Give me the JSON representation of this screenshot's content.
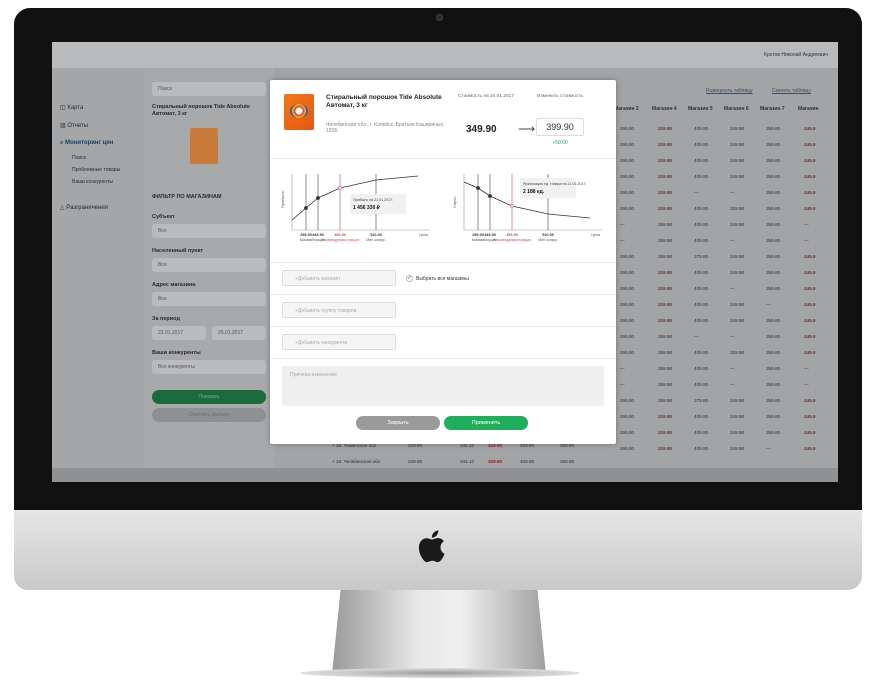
{
  "topbar": {
    "user": "Кротов Николай Андреевич"
  },
  "sidebar": {
    "items": [
      {
        "label": "Карта"
      },
      {
        "label": "Отчеты"
      },
      {
        "label": "Мониторинг цен"
      }
    ],
    "subitems": [
      {
        "label": "Поиск"
      },
      {
        "label": "Проблемные товары"
      },
      {
        "label": "Ваши конкуренты"
      }
    ],
    "extra": {
      "label": "Разграничения"
    }
  },
  "filters": {
    "search": "Поиск",
    "product": "Стиральный порошок Tide Absolute Автомат, 3 кг",
    "title": "ФИЛЬТР ПО МАГАЗИНАМ",
    "subject_label": "Субъект",
    "subject_value": "Все",
    "city_label": "Населенный пункт",
    "city_value": "Все",
    "address_label": "Адрес магазина",
    "address_value": "Все",
    "period_label": "За период",
    "date_from": "22.01.2017",
    "date_to": "25.01.2017",
    "competitors_label": "Ваши конкуренты",
    "competitors_value": "Все конкуренты",
    "show": "Показать",
    "clear": "Очистить фильтр"
  },
  "table": {
    "links": [
      "Развернуть таблицу",
      "Скачать таблицу"
    ],
    "headers": [
      "Магазин 2",
      "Магазин 4",
      "Магазин 5",
      "Магазин 6",
      "Магазин 7",
      "Магазин"
    ],
    "rows": [
      [
        "299.90",
        "329.90",
        "409.90",
        "349.90",
        "359.90",
        "345.9"
      ],
      [
        "299.90",
        "329.90",
        "409.90",
        "349.90",
        "359.90",
        "345.9"
      ],
      [
        "299.90",
        "329.90",
        "409.90",
        "349.90",
        "359.90",
        "345.9"
      ],
      [
        "299.90",
        "329.90",
        "409.90",
        "349.90",
        "359.90",
        "345.9"
      ],
      [
        "299.90",
        "329.90",
        "—",
        "—",
        "359.90",
        "345.9"
      ],
      [
        "299.90",
        "329.90",
        "409.90",
        "329.90",
        "359.90",
        "349.9"
      ],
      [
        "—",
        "359.90",
        "409.90",
        "349.90",
        "359.90",
        "—"
      ],
      [
        "—",
        "359.90",
        "409.90",
        "—",
        "359.90",
        "—"
      ],
      [
        "299.90",
        "359.90",
        "379.90",
        "349.90",
        "359.90",
        "345.9"
      ],
      [
        "299.90",
        "329.90",
        "409.90",
        "349.90",
        "359.90",
        "345.9"
      ],
      [
        "299.90",
        "329.90",
        "409.90",
        "—",
        "359.90",
        "345.9"
      ],
      [
        "299.90",
        "329.90",
        "409.90",
        "349.90",
        "—",
        "345.9"
      ],
      [
        "299.90",
        "329.90",
        "409.90",
        "349.90",
        "359.90",
        "345.9"
      ],
      [
        "299.90",
        "359.90",
        "—",
        "—",
        "359.90",
        "349.9"
      ],
      [
        "299.90",
        "359.90",
        "409.90",
        "329.90",
        "359.90",
        "349.9"
      ],
      [
        "—",
        "359.90",
        "409.90",
        "—",
        "359.90",
        "—"
      ],
      [
        "—",
        "359.90",
        "409.90",
        "—",
        "359.90",
        "—"
      ],
      [
        "299.90",
        "359.90",
        "379.90",
        "349.90",
        "359.90",
        "345.9"
      ],
      [
        "299.90",
        "329.90",
        "409.90",
        "349.90",
        "359.90",
        "345.9"
      ],
      [
        "299.90",
        "329.90",
        "409.90",
        "349.90",
        "359.90",
        "345.9"
      ],
      [
        "299.90",
        "329.90",
        "409.90",
        "349.90",
        "—",
        "345.9"
      ]
    ],
    "bottom_rows": [
      {
        "name": "+ 18. Тюменская обл",
        "a": "349.90",
        "b": "344.10",
        "c": "329.90",
        "d": "409.90",
        "e": "359.90"
      },
      {
        "name": "+ 19. Челябинская обл",
        "a": "349.90",
        "b": "344.10",
        "c": "329.90",
        "d": "409.90",
        "e": "359.90"
      }
    ]
  },
  "modal": {
    "title": "Стиральный порошок Tide Absolute Автомат, 3 кг",
    "address": "Челябинская обл., г. Копейск, Братьев Кашириных, 120Б",
    "cost_label": "Стоимость на 20.01.2017",
    "change_label": "Изменить стоимость",
    "old_price": "349.90",
    "arrow": "⟶",
    "new_price": "399.90",
    "diff": "+50.00",
    "chart1": {
      "ylabel": "Прибыль",
      "tooltip_title": "Прибыль на 21.01.2017:",
      "tooltip_value": "1 456 330 ₽",
      "ticks": [
        "299.90",
        "349.90",
        "359.90",
        "510.00"
      ],
      "tick_labels": [
        "Базовая",
        "Текущая",
        "Рекомендуемая позиция",
        "Мин. конкур."
      ],
      "unit": "Цена"
    },
    "chart2": {
      "ylabel": "Спрос",
      "tooltip_title": "Реализация ед. товара на 21.01.2017:",
      "tooltip_value": "2 188 ед.",
      "ticks": [
        "299.90",
        "349.90",
        "359.90",
        "510.00"
      ],
      "tick_labels": [
        "Базовая",
        "Текущая",
        "Рекомендуемая позиция",
        "Мин. конкур."
      ],
      "unit": "Цена"
    },
    "add_store": "+Добавить магазин",
    "select_all": "Выбрать все магазины",
    "add_group": "+Добавить группу товаров",
    "add_competitor": "+Добавить конкурента",
    "reason": "Причина изменения",
    "close": "Закрыть",
    "apply": "Применить"
  },
  "colors": {
    "accent": "#1fae5b",
    "red": "#e8434a",
    "gray_btn": "#9a9a9a"
  }
}
